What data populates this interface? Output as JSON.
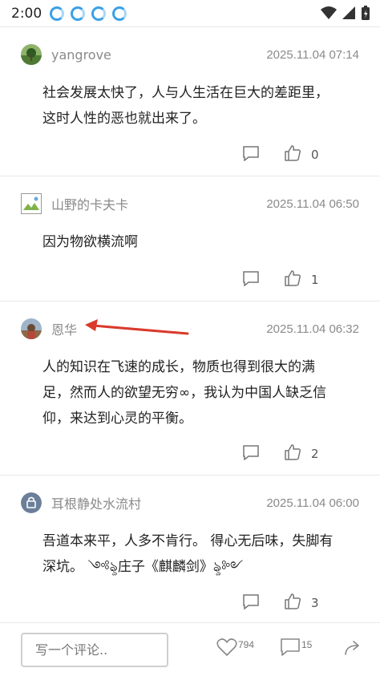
{
  "status_bar": {
    "time": "2:00"
  },
  "comments": [
    {
      "username": "yangrove",
      "time": "2025.11.04 07:14",
      "body_lines": [
        "社会发展太快了，人与人生活在巨大的差距里，",
        "这时人性的恶也就出来了。"
      ],
      "likes": "0"
    },
    {
      "username": "山野的卡夫卡",
      "time": "2025.11.04 06:50",
      "body_lines": [
        "因为物欲横流啊"
      ],
      "likes": "1"
    },
    {
      "username": "恩华",
      "time": "2025.11.04 06:32",
      "body_lines": [
        "人的知识在飞速的成长，物质也得到很大的满",
        "足，然而人的欲望无穷∞，我认为中国人缺乏信",
        "仰，来达到心灵的平衡。"
      ],
      "likes": "2"
    },
    {
      "username": "耳根静处水流村",
      "time": "2025.11.04 06:00",
      "body_lines": [
        "吾道本来平，人多不肯行。 得心无后味，失脚有",
        "深坑。 ༺ৡ庄子《麒麟剑》ৡ༻"
      ],
      "likes": "3"
    }
  ],
  "bottom_bar": {
    "input_placeholder": "写一个评论..",
    "like_count": "794",
    "comment_count": "15"
  },
  "colors": {
    "annotation_arrow": "#d93a2b",
    "text_secondary": "#8a8a8a"
  }
}
